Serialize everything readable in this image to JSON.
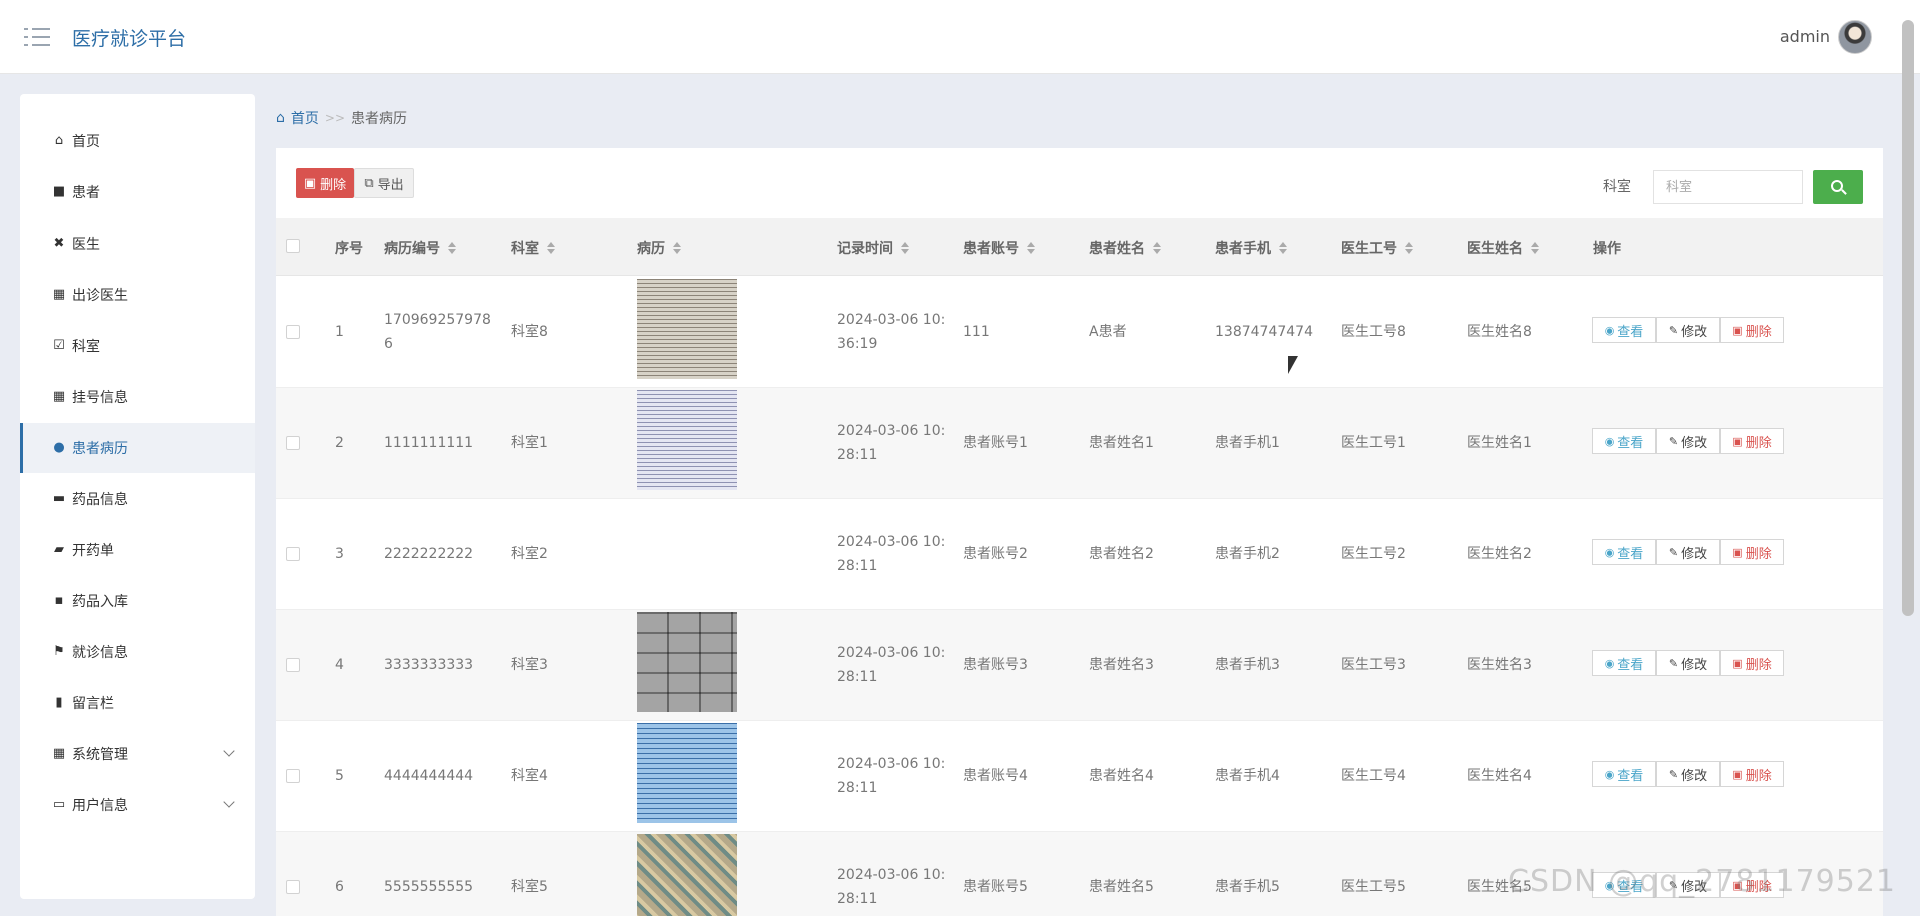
{
  "header": {
    "app_title": "医疗就诊平台",
    "user_name": "admin"
  },
  "sidebar": {
    "items": [
      {
        "label": "首页",
        "icon": "home-icon"
      },
      {
        "label": "患者",
        "icon": "monitor-icon"
      },
      {
        "label": "医生",
        "icon": "clipboard-x-icon"
      },
      {
        "label": "出诊医生",
        "icon": "grid-icon"
      },
      {
        "label": "科室",
        "icon": "clipboard-check-icon"
      },
      {
        "label": "挂号信息",
        "icon": "grid-icon"
      },
      {
        "label": "患者病历",
        "icon": "user-icon",
        "active": true
      },
      {
        "label": "药品信息",
        "icon": "inbox-icon"
      },
      {
        "label": "开药单",
        "icon": "briefcase-icon"
      },
      {
        "label": "药品入库",
        "icon": "comment-icon"
      },
      {
        "label": "就诊信息",
        "icon": "flag-icon"
      },
      {
        "label": "留言栏",
        "icon": "book-icon"
      },
      {
        "label": "系统管理",
        "icon": "grid-icon",
        "expandable": true
      },
      {
        "label": "用户信息",
        "icon": "card-icon",
        "expandable": true
      }
    ]
  },
  "breadcrumb": {
    "home": "首页",
    "separator": ">>",
    "current": "患者病历"
  },
  "toolbar": {
    "delete_label": "删除",
    "export_label": "导出",
    "filter_label": "科室",
    "filter_placeholder": "科室"
  },
  "table": {
    "columns": [
      "序号",
      "病历编号",
      "科室",
      "病历",
      "记录时间",
      "患者账号",
      "患者姓名",
      "患者手机",
      "医生工号",
      "医生姓名",
      "操作"
    ],
    "rows": [
      {
        "no": "1",
        "code_l1": "170969257978",
        "code_l2": "6",
        "dept": "科室8",
        "time_l1": "2024-03-06 10:",
        "time_l2": "36:19",
        "account": "111",
        "name": "A患者",
        "phone": "13874747474",
        "doc_id": "医生工号8",
        "doc_name": "医生姓名8"
      },
      {
        "no": "2",
        "code_l1": "1111111111",
        "code_l2": "",
        "dept": "科室1",
        "time_l1": "2024-03-06 10:",
        "time_l2": "28:11",
        "account": "患者账号1",
        "name": "患者姓名1",
        "phone": "患者手机1",
        "doc_id": "医生工号1",
        "doc_name": "医生姓名1"
      },
      {
        "no": "3",
        "code_l1": "2222222222",
        "code_l2": "",
        "dept": "科室2",
        "time_l1": "2024-03-06 10:",
        "time_l2": "28:11",
        "account": "患者账号2",
        "name": "患者姓名2",
        "phone": "患者手机2",
        "doc_id": "医生工号2",
        "doc_name": "医生姓名2"
      },
      {
        "no": "4",
        "code_l1": "3333333333",
        "code_l2": "",
        "dept": "科室3",
        "time_l1": "2024-03-06 10:",
        "time_l2": "28:11",
        "account": "患者账号3",
        "name": "患者姓名3",
        "phone": "患者手机3",
        "doc_id": "医生工号3",
        "doc_name": "医生姓名3"
      },
      {
        "no": "5",
        "code_l1": "4444444444",
        "code_l2": "",
        "dept": "科室4",
        "time_l1": "2024-03-06 10:",
        "time_l2": "28:11",
        "account": "患者账号4",
        "name": "患者姓名4",
        "phone": "患者手机4",
        "doc_id": "医生工号4",
        "doc_name": "医生姓名4"
      },
      {
        "no": "6",
        "code_l1": "5555555555",
        "code_l2": "",
        "dept": "科室5",
        "time_l1": "2024-03-06 10:",
        "time_l2": "28:11",
        "account": "患者账号5",
        "name": "患者姓名5",
        "phone": "患者手机5",
        "doc_id": "医生工号5",
        "doc_name": "医生姓名5"
      }
    ],
    "actions": {
      "view": "查看",
      "edit": "修改",
      "delete": "删除"
    }
  },
  "watermark": "CSDN @qq_2781179521",
  "colors": {
    "accent": "#2d6ea7",
    "danger": "#d9534f",
    "success": "#4cae4c",
    "info": "#4aa5c9"
  }
}
